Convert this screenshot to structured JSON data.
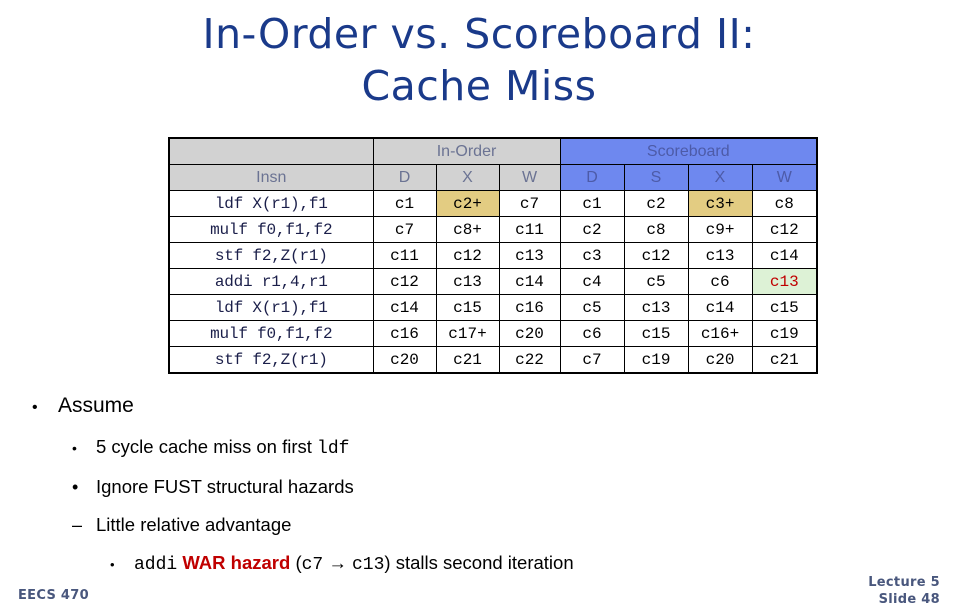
{
  "title": {
    "line1": "In-Order vs. Scoreboard II:",
    "line2": "Cache Miss",
    "color": "#1a3a8a"
  },
  "table": {
    "group_headers": {
      "blank": "",
      "in_order": "In-Order",
      "scoreboard": "Scoreboard"
    },
    "column_headers": {
      "insn": "Insn",
      "in_order": [
        "D",
        "X",
        "W"
      ],
      "scoreboard": [
        "D",
        "S",
        "X",
        "W"
      ]
    },
    "colors": {
      "gray_header_bg": "#d2d2d2",
      "blue_header_bg": "#6e88ef",
      "header_text": "#6b7393",
      "blue_header_text": "#4d5ba8",
      "highlight_yellow": "#e3cc82",
      "highlight_green_bg": "#ddf2d6",
      "highlight_green_text": "#c00000",
      "insn_text": "#1b1f4a",
      "border": "#000000"
    },
    "rows": [
      {
        "insn": "ldf X(r1),f1",
        "in_order": [
          {
            "v": "c1",
            "hl": ""
          },
          {
            "v": "c2+",
            "hl": "yellow"
          },
          {
            "v": "c7",
            "hl": ""
          }
        ],
        "scoreboard": [
          {
            "v": "c1",
            "hl": ""
          },
          {
            "v": "c2",
            "hl": ""
          },
          {
            "v": "c3+",
            "hl": "yellow"
          },
          {
            "v": "c8",
            "hl": ""
          }
        ]
      },
      {
        "insn": "mulf f0,f1,f2",
        "in_order": [
          {
            "v": "c7",
            "hl": ""
          },
          {
            "v": "c8+",
            "hl": ""
          },
          {
            "v": "c11",
            "hl": ""
          }
        ],
        "scoreboard": [
          {
            "v": "c2",
            "hl": ""
          },
          {
            "v": "c8",
            "hl": ""
          },
          {
            "v": "c9+",
            "hl": ""
          },
          {
            "v": "c12",
            "hl": ""
          }
        ]
      },
      {
        "insn": "stf f2,Z(r1)",
        "in_order": [
          {
            "v": "c11",
            "hl": ""
          },
          {
            "v": "c12",
            "hl": ""
          },
          {
            "v": "c13",
            "hl": ""
          }
        ],
        "scoreboard": [
          {
            "v": "c3",
            "hl": ""
          },
          {
            "v": "c12",
            "hl": ""
          },
          {
            "v": "c13",
            "hl": ""
          },
          {
            "v": "c14",
            "hl": ""
          }
        ]
      },
      {
        "insn": "addi r1,4,r1",
        "in_order": [
          {
            "v": "c12",
            "hl": ""
          },
          {
            "v": "c13",
            "hl": ""
          },
          {
            "v": "c14",
            "hl": ""
          }
        ],
        "scoreboard": [
          {
            "v": "c4",
            "hl": ""
          },
          {
            "v": "c5",
            "hl": ""
          },
          {
            "v": "c6",
            "hl": ""
          },
          {
            "v": "c13",
            "hl": "green"
          }
        ]
      },
      {
        "insn": "ldf X(r1),f1",
        "in_order": [
          {
            "v": "c14",
            "hl": ""
          },
          {
            "v": "c15",
            "hl": ""
          },
          {
            "v": "c16",
            "hl": ""
          }
        ],
        "scoreboard": [
          {
            "v": "c5",
            "hl": ""
          },
          {
            "v": "c13",
            "hl": ""
          },
          {
            "v": "c14",
            "hl": ""
          },
          {
            "v": "c15",
            "hl": ""
          }
        ]
      },
      {
        "insn": "mulf f0,f1,f2",
        "in_order": [
          {
            "v": "c16",
            "hl": ""
          },
          {
            "v": "c17+",
            "hl": ""
          },
          {
            "v": "c20",
            "hl": ""
          }
        ],
        "scoreboard": [
          {
            "v": "c6",
            "hl": ""
          },
          {
            "v": "c15",
            "hl": ""
          },
          {
            "v": "c16+",
            "hl": ""
          },
          {
            "v": "c19",
            "hl": ""
          }
        ]
      },
      {
        "insn": "stf f2,Z(r1)",
        "in_order": [
          {
            "v": "c20",
            "hl": ""
          },
          {
            "v": "c21",
            "hl": ""
          },
          {
            "v": "c22",
            "hl": ""
          }
        ],
        "scoreboard": [
          {
            "v": "c7",
            "hl": ""
          },
          {
            "v": "c19",
            "hl": ""
          },
          {
            "v": "c20",
            "hl": ""
          },
          {
            "v": "c21",
            "hl": ""
          }
        ]
      }
    ]
  },
  "bullets": {
    "b1": {
      "marker": "•",
      "text": "Assume"
    },
    "b2": {
      "marker": "•",
      "text_pre": "5 cycle cache miss on first ",
      "mono": "ldf"
    },
    "b3": {
      "marker": "•",
      "text": "Ignore FUST structural hazards"
    },
    "b4": {
      "marker": "–",
      "text": "Little relative advantage"
    },
    "b5": {
      "marker": "•",
      "mono1": "addi",
      "warn": "WAR hazard",
      "paren_open": "(",
      "mono2": "c7",
      "arrow": "→",
      "mono3": "c13",
      "paren_close": ")",
      "tail": "stalls second iteration"
    }
  },
  "footer": {
    "course": "EECS 470",
    "lecture": "Lecture 5",
    "slide": "Slide 48",
    "color": "#49577d"
  }
}
